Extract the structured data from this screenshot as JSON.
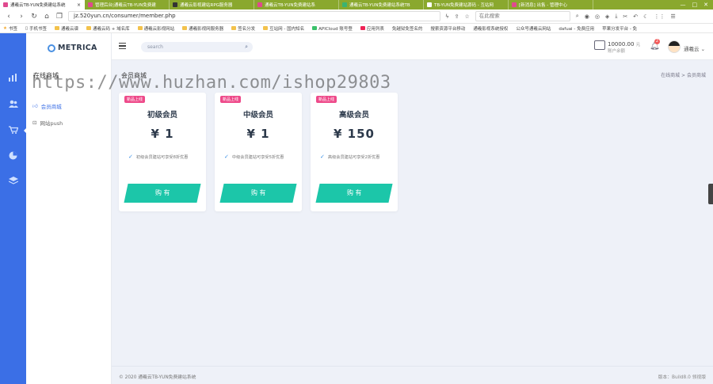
{
  "browser": {
    "tabs": [
      {
        "label": "通羲云TB-YUN免费建站系统",
        "active": true
      },
      {
        "label": "管理后台|通羲云TB-YUN免费建",
        "active": false
      },
      {
        "label": "通羲云影视建站RPG服务器",
        "active": false
      },
      {
        "label": "通羲云TB-YUN免费建站系",
        "active": false
      },
      {
        "label": "通羲云TB-YUN免费建站系统TB",
        "active": false
      },
      {
        "label": "TB-YUN免费建站源码 - 互站网",
        "active": false
      },
      {
        "label": "[新消息] 出售 - 管理中心",
        "active": false
      }
    ],
    "url": "jz.520yun.cn/consumer/member.php",
    "search_placeholder": "在此搜索",
    "bookmarks": [
      "书签",
      "手机书签",
      "通羲云谱",
      "通羲云码 + 域名库",
      "通羲云影视网站",
      "通羲影视网服务器",
      "签名分发",
      "互站网 - 国内知名",
      "APICloud 账号登",
      "应用列表",
      "免越狱免签名的",
      "搜索资源平台移动",
      "通羲影视系统授权",
      "公众号通羲云网站",
      "dafuai - 免费应用",
      "苹果分发平台 - 免"
    ]
  },
  "sidebar": {
    "brand": "METRICA",
    "section_title": "在线商城",
    "items": [
      {
        "label": "会员商城",
        "active": true
      },
      {
        "label": "网站push",
        "active": false
      }
    ]
  },
  "topbar": {
    "search_placeholder": "search",
    "balance": "10000.00",
    "balance_unit": "元",
    "balance_sub": "账户余额",
    "notifications": "2",
    "username": "通羲云"
  },
  "main": {
    "page_title": "会员商城",
    "breadcrumb": [
      "在线商城",
      ">",
      "会员商城"
    ],
    "ribbon": "新品上线",
    "cards": [
      {
        "name": "初级会员",
        "price": "¥ 1",
        "feature": "初级会员建站可享受8折优惠",
        "buy": "购 有"
      },
      {
        "name": "中级会员",
        "price": "¥ 1",
        "feature": "中级会员建站可享受5折优惠",
        "buy": "购 有"
      },
      {
        "name": "高级会员",
        "price": "¥ 150",
        "feature": "高级会员建站可享受2折优惠",
        "buy": "购 有"
      }
    ]
  },
  "footer": {
    "copyright": "© 2020 通羲云TB-YUN免费建站系统",
    "version": "版本：Build8.0 领视版"
  },
  "watermark": "https://www.huzhan.com/ishop29803"
}
